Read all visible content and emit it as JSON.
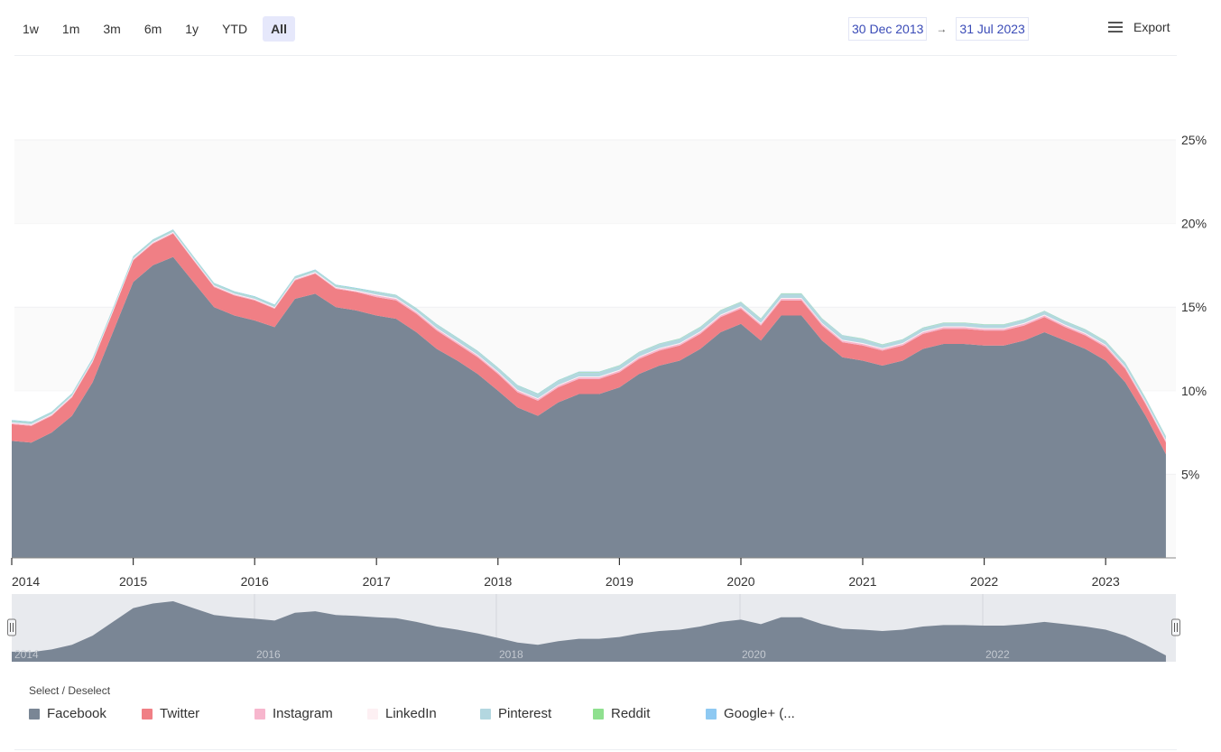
{
  "toolbar": {
    "ranges": [
      "1w",
      "1m",
      "3m",
      "6m",
      "1y",
      "YTD",
      "All"
    ],
    "active": "All"
  },
  "date_range": {
    "from": "30 Dec 2013",
    "arrow": "→",
    "to": "31 Jul 2023"
  },
  "export_label": "Export",
  "legend_title": "Select / Deselect",
  "legend": [
    {
      "name": "Facebook",
      "color": "#7a8695"
    },
    {
      "name": "Twitter",
      "color": "#f07f85"
    },
    {
      "name": "Instagram",
      "color": "#f7b6cd"
    },
    {
      "name": "LinkedIn",
      "color": "#fdf0f3"
    },
    {
      "name": "Pinterest",
      "color": "#b3d7e0"
    },
    {
      "name": "Reddit",
      "color": "#8fe08f"
    },
    {
      "name": "Google+ (...",
      "color": "#8ec9f2"
    }
  ],
  "chart_data": {
    "type": "area",
    "stacked": true,
    "title": "",
    "xlabel": "",
    "ylabel": "",
    "x_ticks": [
      "2014",
      "2015",
      "2016",
      "2017",
      "2018",
      "2019",
      "2020",
      "2021",
      "2022",
      "2023"
    ],
    "y_ticks": [
      "5%",
      "10%",
      "15%",
      "20%",
      "25%"
    ],
    "ylim": [
      0,
      25
    ],
    "xlim": [
      "2014-01-01",
      "2023-07-31"
    ],
    "y_axis_position": "right",
    "grid": "alternating horizontal bands",
    "x": [
      "2014-01",
      "2014-03",
      "2014-05",
      "2014-07",
      "2014-09",
      "2014-11",
      "2015-01",
      "2015-03",
      "2015-05",
      "2015-07",
      "2015-09",
      "2015-11",
      "2016-01",
      "2016-03",
      "2016-05",
      "2016-07",
      "2016-09",
      "2016-11",
      "2017-01",
      "2017-03",
      "2017-05",
      "2017-07",
      "2017-09",
      "2017-11",
      "2018-01",
      "2018-03",
      "2018-05",
      "2018-07",
      "2018-09",
      "2018-11",
      "2019-01",
      "2019-03",
      "2019-05",
      "2019-07",
      "2019-09",
      "2019-11",
      "2020-01",
      "2020-03",
      "2020-05",
      "2020-07",
      "2020-09",
      "2020-11",
      "2021-01",
      "2021-03",
      "2021-05",
      "2021-07",
      "2021-09",
      "2021-11",
      "2022-01",
      "2022-03",
      "2022-05",
      "2022-07",
      "2022-09",
      "2022-11",
      "2023-01",
      "2023-03",
      "2023-05",
      "2023-07"
    ],
    "series": [
      {
        "name": "Facebook",
        "values": [
          7.0,
          6.9,
          7.5,
          8.5,
          10.5,
          13.5,
          16.5,
          17.5,
          18.0,
          16.5,
          15.0,
          14.5,
          14.2,
          13.8,
          15.5,
          15.8,
          15.0,
          14.8,
          14.5,
          14.3,
          13.5,
          12.5,
          11.8,
          11.0,
          10.0,
          9.0,
          8.5,
          9.3,
          9.8,
          9.8,
          10.2,
          11.0,
          11.5,
          11.8,
          12.5,
          13.5,
          14.0,
          13.0,
          14.5,
          14.5,
          13.0,
          12.0,
          11.8,
          11.5,
          11.8,
          12.5,
          12.8,
          12.8,
          12.7,
          12.7,
          13.0,
          13.5,
          13.0,
          12.5,
          11.8,
          10.5,
          8.5,
          6.2
        ]
      },
      {
        "name": "Twitter",
        "values": [
          1.0,
          1.0,
          1.0,
          1.1,
          1.2,
          1.2,
          1.3,
          1.3,
          1.4,
          1.3,
          1.2,
          1.2,
          1.2,
          1.1,
          1.1,
          1.2,
          1.1,
          1.1,
          1.1,
          1.1,
          1.1,
          1.1,
          1.0,
          1.0,
          1.0,
          0.9,
          0.9,
          0.9,
          0.9,
          0.9,
          0.9,
          0.9,
          0.9,
          0.9,
          0.9,
          0.9,
          0.9,
          0.9,
          0.9,
          0.9,
          0.9,
          0.9,
          0.9,
          0.9,
          0.9,
          0.9,
          0.9,
          0.9,
          0.9,
          0.9,
          0.9,
          0.9,
          0.8,
          0.8,
          0.8,
          0.8,
          0.7,
          0.7
        ]
      },
      {
        "name": "Instagram",
        "values": [
          0.05,
          0.05,
          0.05,
          0.05,
          0.05,
          0.05,
          0.05,
          0.05,
          0.05,
          0.05,
          0.05,
          0.05,
          0.05,
          0.05,
          0.05,
          0.05,
          0.05,
          0.05,
          0.1,
          0.1,
          0.1,
          0.1,
          0.1,
          0.1,
          0.1,
          0.1,
          0.1,
          0.1,
          0.1,
          0.1,
          0.1,
          0.1,
          0.1,
          0.1,
          0.1,
          0.1,
          0.1,
          0.1,
          0.1,
          0.1,
          0.1,
          0.1,
          0.1,
          0.1,
          0.1,
          0.1,
          0.1,
          0.1,
          0.1,
          0.1,
          0.1,
          0.1,
          0.1,
          0.1,
          0.1,
          0.1,
          0.1,
          0.1
        ]
      },
      {
        "name": "LinkedIn",
        "values": [
          0.05,
          0.05,
          0.05,
          0.05,
          0.05,
          0.05,
          0.05,
          0.05,
          0.05,
          0.05,
          0.05,
          0.05,
          0.05,
          0.05,
          0.05,
          0.05,
          0.05,
          0.05,
          0.05,
          0.05,
          0.05,
          0.05,
          0.05,
          0.05,
          0.05,
          0.05,
          0.05,
          0.05,
          0.05,
          0.05,
          0.05,
          0.05,
          0.05,
          0.05,
          0.05,
          0.05,
          0.05,
          0.05,
          0.05,
          0.05,
          0.05,
          0.05,
          0.05,
          0.05,
          0.05,
          0.05,
          0.05,
          0.05,
          0.05,
          0.05,
          0.05,
          0.05,
          0.05,
          0.05,
          0.05,
          0.05,
          0.05,
          0.05
        ]
      },
      {
        "name": "Pinterest",
        "values": [
          0.1,
          0.1,
          0.1,
          0.1,
          0.1,
          0.1,
          0.1,
          0.1,
          0.1,
          0.1,
          0.1,
          0.1,
          0.1,
          0.1,
          0.1,
          0.1,
          0.1,
          0.1,
          0.15,
          0.15,
          0.15,
          0.2,
          0.2,
          0.2,
          0.2,
          0.25,
          0.25,
          0.25,
          0.25,
          0.25,
          0.25,
          0.25,
          0.25,
          0.25,
          0.25,
          0.25,
          0.25,
          0.25,
          0.25,
          0.25,
          0.25,
          0.25,
          0.25,
          0.2,
          0.2,
          0.2,
          0.2,
          0.2,
          0.2,
          0.2,
          0.2,
          0.2,
          0.2,
          0.2,
          0.2,
          0.2,
          0.2,
          0.2
        ]
      },
      {
        "name": "Reddit",
        "values": [
          0.02,
          0.02,
          0.02,
          0.02,
          0.02,
          0.02,
          0.02,
          0.02,
          0.02,
          0.02,
          0.02,
          0.02,
          0.02,
          0.02,
          0.02,
          0.02,
          0.02,
          0.02,
          0.02,
          0.02,
          0.02,
          0.02,
          0.02,
          0.02,
          0.02,
          0.02,
          0.02,
          0.02,
          0.02,
          0.02,
          0.02,
          0.02,
          0.02,
          0.02,
          0.02,
          0.02,
          0.02,
          0.02,
          0.02,
          0.02,
          0.02,
          0.02,
          0.02,
          0.02,
          0.02,
          0.02,
          0.02,
          0.02,
          0.02,
          0.02,
          0.02,
          0.02,
          0.02,
          0.02,
          0.02,
          0.02,
          0.02,
          0.02
        ]
      },
      {
        "name": "Google+ (...",
        "values": [
          0.03,
          0.03,
          0.03,
          0.03,
          0.03,
          0.03,
          0.03,
          0.03,
          0.03,
          0.03,
          0.03,
          0.03,
          0.03,
          0.03,
          0.03,
          0.03,
          0.03,
          0.03,
          0.02,
          0.02,
          0.02,
          0.02,
          0.02,
          0.02,
          0.02,
          0.02,
          0.02,
          0.02,
          0.02,
          0.02,
          0.01,
          0.01,
          0.01,
          0.01,
          0.01,
          0.01,
          0.01,
          0.01,
          0.01,
          0.01,
          0.01,
          0.01,
          0.01,
          0.01,
          0.01,
          0.01,
          0.01,
          0.01,
          0.01,
          0.01,
          0.01,
          0.01,
          0.01,
          0.01,
          0.01,
          0.01,
          0.01,
          0.01
        ]
      }
    ],
    "navigator": {
      "x_labels": [
        "2014",
        "2016",
        "2018",
        "2020",
        "2022"
      ]
    }
  }
}
